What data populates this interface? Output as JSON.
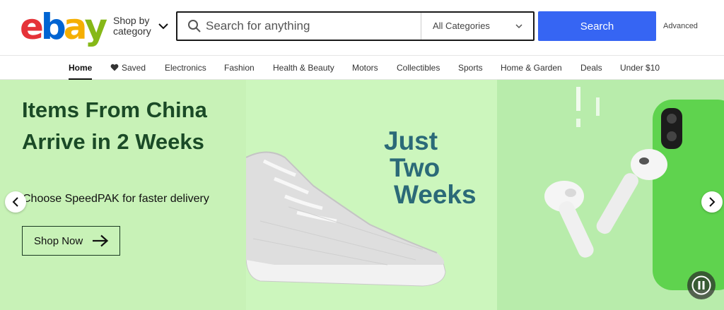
{
  "header": {
    "logo_letters": [
      "e",
      "b",
      "a",
      "y"
    ],
    "logo_colors": [
      "#e53238",
      "#0064d2",
      "#f5af02",
      "#86b817"
    ],
    "shop_by_line1": "Shop by",
    "shop_by_line2": "category",
    "search_placeholder": "Search for anything",
    "category_selected": "All Categories",
    "search_button": "Search",
    "advanced_link": "Advanced"
  },
  "nav": {
    "items": [
      "Home",
      "Saved",
      "Electronics",
      "Fashion",
      "Health & Beauty",
      "Motors",
      "Collectibles",
      "Sports",
      "Home & Garden",
      "Deals",
      "Under $10"
    ],
    "active": "Home"
  },
  "hero": {
    "title": "Items From China Arrive in 2 Weeks",
    "subtitle": "Choose SpeedPAK for faster delivery",
    "cta": "Shop Now",
    "promo_line1": "Just",
    "promo_line2": "Two",
    "promo_line3": "Weeks"
  },
  "colors": {
    "accent_blue": "#3665f3",
    "hero_green": "#c8f2b7",
    "title_green": "#1a4a26",
    "promo_teal": "#2b6a78"
  },
  "icons": {
    "search": "search-icon",
    "chevron": "chevron-down-icon",
    "heart": "heart-icon",
    "arrow": "arrow-right-icon",
    "prev": "chevron-left-icon",
    "next": "chevron-right-icon",
    "pause": "pause-icon"
  }
}
